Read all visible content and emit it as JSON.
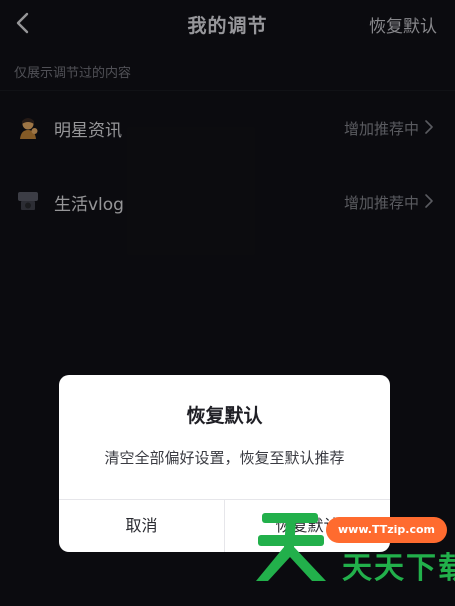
{
  "header": {
    "title": "我的调节",
    "reset_label": "恢复默认"
  },
  "subtitle": "仅展示调节过的内容",
  "list": [
    {
      "icon": "star-person-emoji-icon",
      "label": "明星资讯",
      "status": "增加推荐中"
    },
    {
      "icon": "vlog-camera-icon",
      "label": "生活vlog",
      "status": "增加推荐中"
    }
  ],
  "dialog": {
    "title": "恢复默认",
    "message": "清空全部偏好设置，恢复至默认推荐",
    "cancel_label": "取消",
    "confirm_label": "恢复默认"
  },
  "watermark": {
    "url": "www.TTzip.com",
    "text": "天天下载"
  },
  "colors": {
    "background": "#121217",
    "dialog_bg": "#ffffff",
    "watermark_green": "#22b04b",
    "watermark_orange": "#ff6b2f"
  }
}
